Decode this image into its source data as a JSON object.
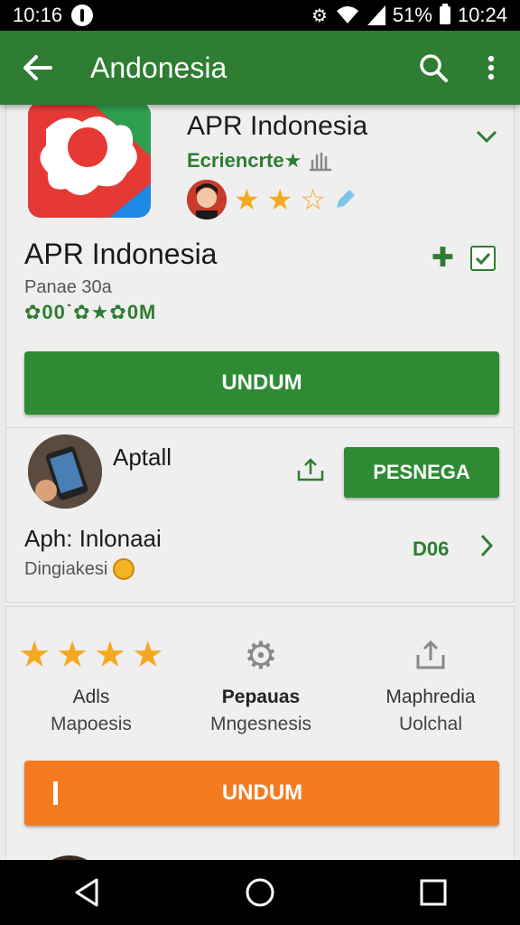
{
  "status_bar": {
    "left_time": "10:16",
    "battery_text": "51%",
    "right_time": "10:24"
  },
  "app_bar": {
    "title": "Andonesia"
  },
  "app_header": {
    "title": "APR Indonesia",
    "developer": "Ecriencrte★",
    "rating_stars": 2.5
  },
  "app_detail": {
    "title": "APR Indonesia",
    "subtitle": "Panae 30a",
    "meta": "✿00˙✿★✿0M",
    "install_button": "UNDUM"
  },
  "related": {
    "name": "Aptall",
    "button": "PESNEGA"
  },
  "row2": {
    "title": "Aph: Inlonaai",
    "subtitle": "Dingiakesi",
    "size": "D06"
  },
  "stats": [
    {
      "icon": "stars-icon",
      "line1": "Adls",
      "line2": "Mapoesis"
    },
    {
      "icon": "gear-icon",
      "line1": "Pepauas",
      "line2": "Mngesnesis"
    },
    {
      "icon": "share-icon",
      "line1": "Maphredia",
      "line2": "Uolchal"
    }
  ],
  "orange_button": {
    "label": "UNDUM"
  },
  "colors": {
    "primary": "#2e7d32",
    "button_green": "#2e8b34",
    "accent_orange": "#f47b20",
    "star": "#f6a821"
  }
}
